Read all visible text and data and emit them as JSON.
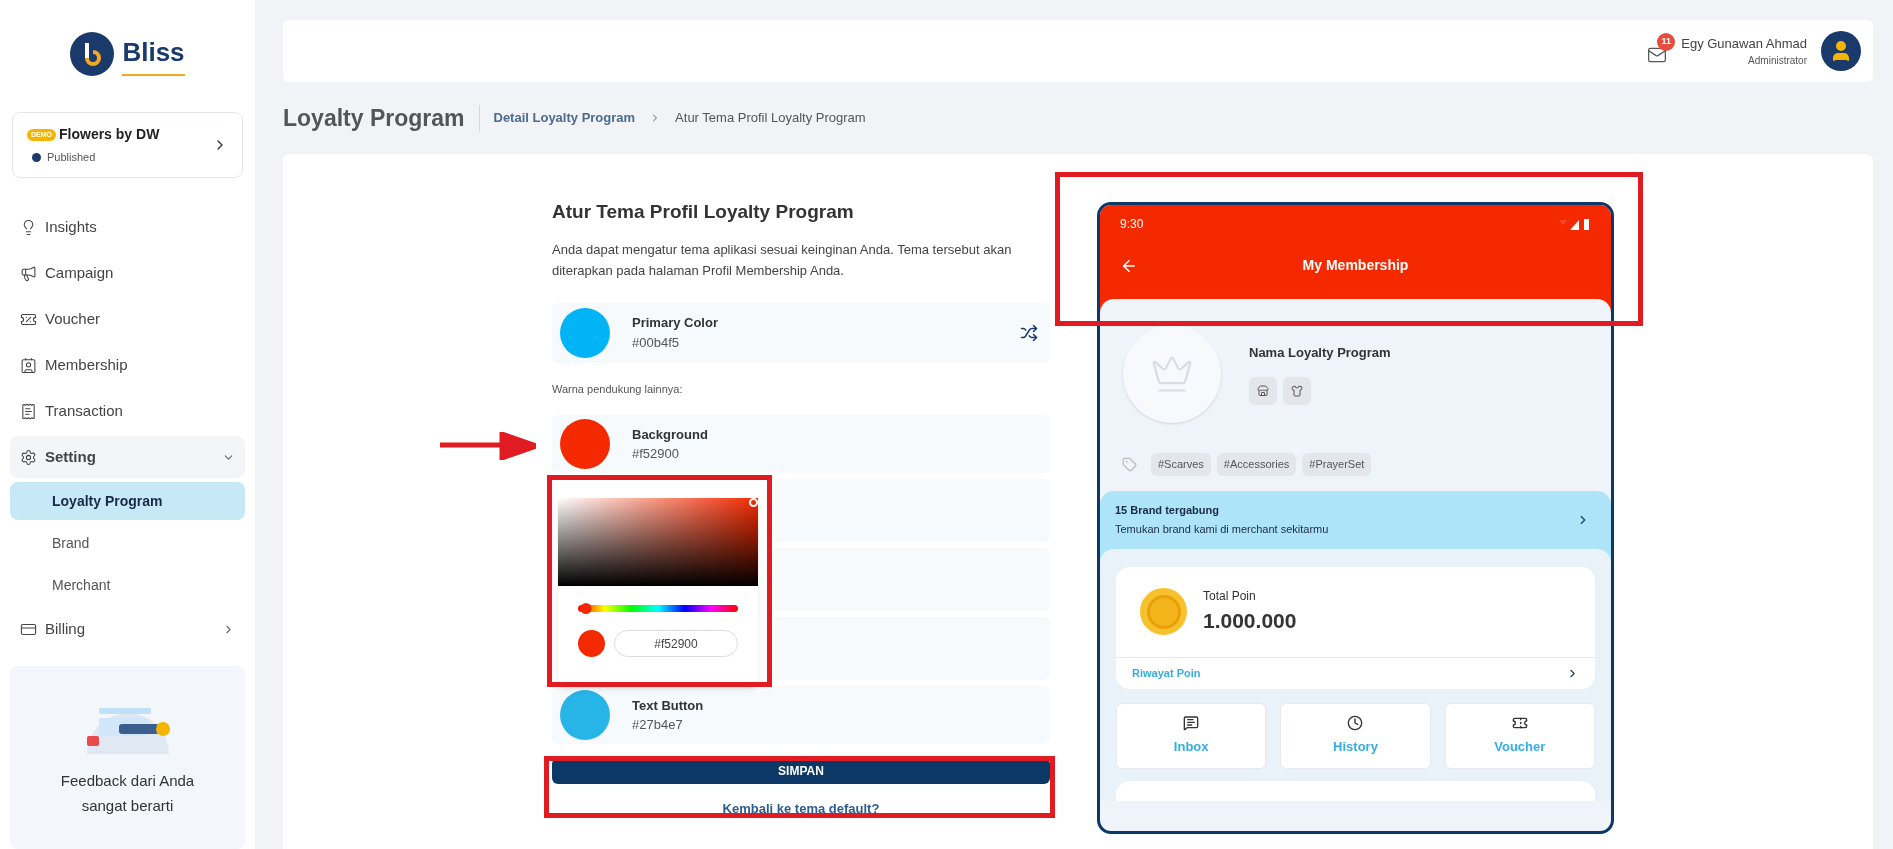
{
  "brand": {
    "name": "Bliss"
  },
  "store": {
    "badge": "DEMO",
    "name": "Flowers by DW",
    "status": "Published"
  },
  "nav": [
    {
      "kind": "bulb",
      "label": "Insights",
      "selected": false
    },
    {
      "kind": "megaphone",
      "label": "Campaign",
      "selected": false
    },
    {
      "kind": "ticket",
      "label": "Voucher",
      "selected": false
    },
    {
      "kind": "id",
      "label": "Membership",
      "selected": false
    },
    {
      "kind": "receipt",
      "label": "Transaction",
      "selected": false
    },
    {
      "kind": "gear",
      "label": "Setting",
      "selected": false,
      "expanded": true,
      "children": [
        {
          "label": "Loyalty Program",
          "selected": true
        },
        {
          "label": "Brand",
          "selected": false
        },
        {
          "label": "Merchant",
          "selected": false
        }
      ]
    },
    {
      "kind": "card",
      "label": "Billing",
      "selected": false,
      "expanded": false
    }
  ],
  "feedback": {
    "text": "Feedback dari Anda sangat berarti"
  },
  "header": {
    "notifications": "11",
    "user_name": "Egy Gunawan Ahmad",
    "user_role": "Administrator"
  },
  "page": {
    "title": "Loyalty Program",
    "breadcrumb": [
      "Detail Loyalty Program",
      "Atur Tema Profil Loyalty Program"
    ]
  },
  "form": {
    "title": "Atur Tema Profil Loyalty Program",
    "description": "Anda dapat mengatur tema aplikasi sesuai keinginan Anda. Tema tersebut akan diterapkan pada halaman Profil Membership Anda.",
    "primary": {
      "label": "Primary Color",
      "value": "#00b4f5",
      "color": "#00b4f5"
    },
    "support_label": "Warna pendukung lainnya:",
    "supporting_top": {
      "label": "Background",
      "value": "#f52900",
      "color": "#f52900"
    },
    "supporting_bottom": {
      "label": "Text Button",
      "value": "#27b4e7",
      "color": "#27b4e7"
    },
    "picker": {
      "color": "#f52900",
      "value": "#f52900",
      "level": 0.02
    },
    "save": "SIMPAN",
    "reset_link": "Kembali ke tema default?"
  },
  "phone": {
    "time": "9:30",
    "title": "My Membership",
    "program_name": "Nama Loyalty Program",
    "tags": [
      "#Scarves",
      "#Accessories",
      "#PrayerSet"
    ],
    "brand_banner": {
      "title": "15 Brand tergabung",
      "subtitle": "Temukan brand kami di merchant sekitarmu"
    },
    "points": {
      "label": "Total Poin",
      "value": "1.000.000",
      "history_link": "Riwayat Poin"
    },
    "shortcuts": [
      {
        "kind": "inbox",
        "label": "Inbox"
      },
      {
        "kind": "history",
        "label": "History"
      },
      {
        "kind": "voucher",
        "label": "Voucher"
      }
    ]
  }
}
